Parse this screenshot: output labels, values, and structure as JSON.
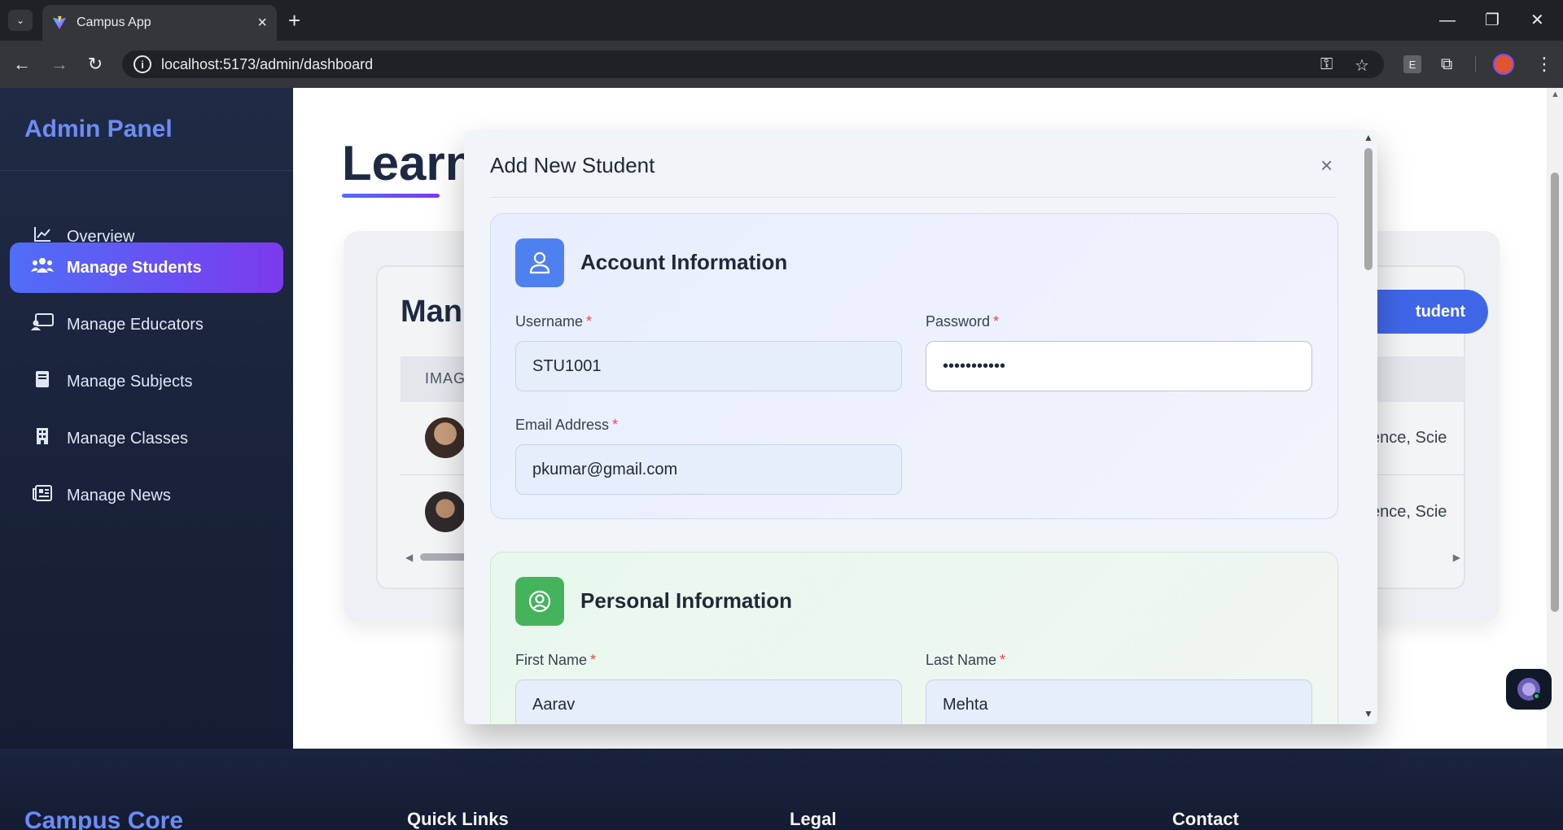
{
  "browser": {
    "tab_title": "Campus App",
    "url": "localhost:5173/admin/dashboard",
    "profile_color": "#e0552f",
    "extension_label": "E"
  },
  "sidebar": {
    "title": "Admin Panel",
    "items": [
      {
        "label": "Overview",
        "icon": "chart-line-icon"
      },
      {
        "label": "Manage Students",
        "icon": "users-icon",
        "active": true
      },
      {
        "label": "Manage Educators",
        "icon": "chalkboard-teacher-icon"
      },
      {
        "label": "Manage Subjects",
        "icon": "book-icon"
      },
      {
        "label": "Manage Classes",
        "icon": "building-icon"
      },
      {
        "label": "Manage News",
        "icon": "newspaper-icon"
      }
    ]
  },
  "main": {
    "heading": "Learn",
    "card_title": "Man",
    "add_button_label": "tudent",
    "table": {
      "header_image": "IMAG",
      "rows": [
        {
          "subjects": "ence, Scie"
        },
        {
          "subjects": "ence, Scie"
        }
      ]
    }
  },
  "footer": {
    "brand": "Campus Core",
    "columns": [
      "Quick Links",
      "Legal",
      "Contact"
    ]
  },
  "modal": {
    "title": "Add New Student",
    "close": "×",
    "sections": {
      "account": {
        "heading": "Account Information",
        "username_label": "Username",
        "username_value": "STU1001",
        "password_label": "Password",
        "password_value": "•••••••••••",
        "email_label": "Email Address",
        "email_value": "pkumar@gmail.com"
      },
      "personal": {
        "heading": "Personal Information",
        "first_name_label": "First Name",
        "first_name_value": "Aarav",
        "last_name_label": "Last Name",
        "last_name_value": "Mehta"
      }
    },
    "required_marker": "*"
  },
  "colors": {
    "accent_blue": "#4066e8",
    "accent_purple": "#7c3aed",
    "sidebar_bg": "#1f2a44",
    "required": "#ef4444"
  }
}
